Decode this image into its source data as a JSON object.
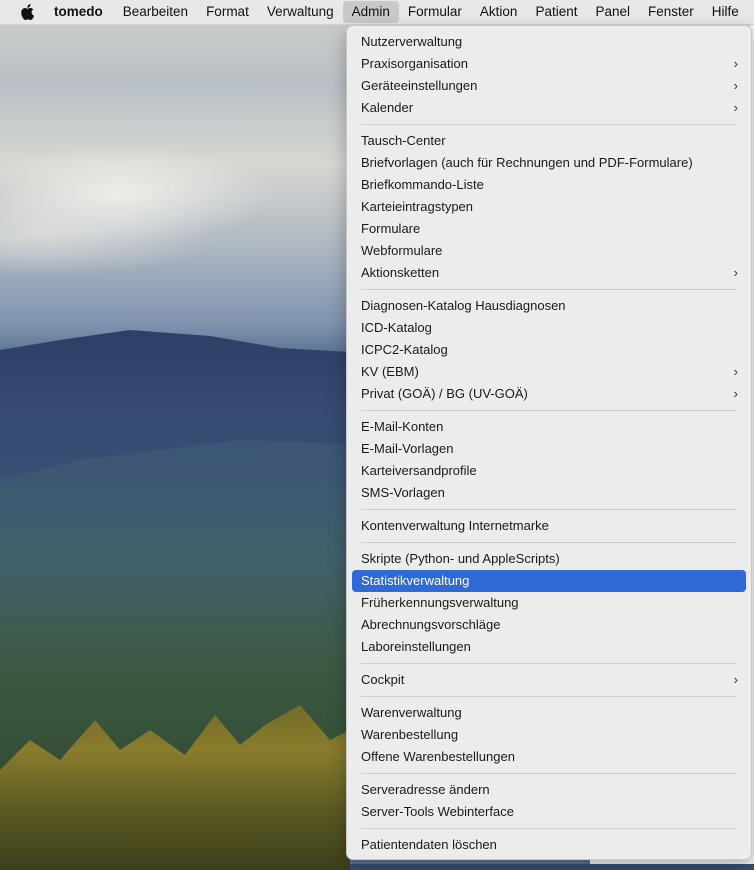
{
  "menubar": {
    "apple_icon": "apple-logo-icon",
    "app_name": "tomedo",
    "items": [
      "Bearbeiten",
      "Format",
      "Verwaltung",
      "Admin",
      "Formular",
      "Aktion",
      "Patient",
      "Panel",
      "Fenster",
      "Hilfe"
    ],
    "active": "Admin"
  },
  "admin_menu": {
    "groups": [
      [
        {
          "label": "Nutzerverwaltung",
          "submenu": false
        },
        {
          "label": "Praxisorganisation",
          "submenu": true
        },
        {
          "label": "Geräteeinstellungen",
          "submenu": true
        },
        {
          "label": "Kalender",
          "submenu": true
        }
      ],
      [
        {
          "label": "Tausch-Center",
          "submenu": false
        },
        {
          "label": "Briefvorlagen (auch für Rechnungen und PDF-Formulare)",
          "submenu": false
        },
        {
          "label": "Briefkommando-Liste",
          "submenu": false
        },
        {
          "label": "Karteieintragstypen",
          "submenu": false
        },
        {
          "label": "Formulare",
          "submenu": false
        },
        {
          "label": "Webformulare",
          "submenu": false
        },
        {
          "label": "Aktionsketten",
          "submenu": true
        }
      ],
      [
        {
          "label": "Diagnosen-Katalog Hausdiagnosen",
          "submenu": false
        },
        {
          "label": "ICD-Katalog",
          "submenu": false
        },
        {
          "label": "ICPC2-Katalog",
          "submenu": false
        },
        {
          "label": "KV (EBM)",
          "submenu": true
        },
        {
          "label": "Privat (GOÄ) / BG (UV-GOÄ)",
          "submenu": true
        }
      ],
      [
        {
          "label": "E-Mail-Konten",
          "submenu": false
        },
        {
          "label": "E-Mail-Vorlagen",
          "submenu": false
        },
        {
          "label": "Karteiversandprofile",
          "submenu": false
        },
        {
          "label": "SMS-Vorlagen",
          "submenu": false
        }
      ],
      [
        {
          "label": "Kontenverwaltung Internetmarke",
          "submenu": false
        }
      ],
      [
        {
          "label": "Skripte (Python- und AppleScripts)",
          "submenu": false
        },
        {
          "label": "Statistikverwaltung",
          "submenu": false,
          "selected": true
        },
        {
          "label": "Früherkennungsverwaltung",
          "submenu": false
        },
        {
          "label": "Abrechnungsvorschläge",
          "submenu": false
        },
        {
          "label": "Laboreinstellungen",
          "submenu": false
        }
      ],
      [
        {
          "label": "Cockpit",
          "submenu": true
        }
      ],
      [
        {
          "label": "Warenverwaltung",
          "submenu": false
        },
        {
          "label": "Warenbestellung",
          "submenu": false
        },
        {
          "label": "Offene Warenbestellungen",
          "submenu": false
        }
      ],
      [
        {
          "label": "Serveradresse ändern",
          "submenu": false
        },
        {
          "label": "Server-Tools Webinterface",
          "submenu": false
        }
      ],
      [
        {
          "label": "Patientendaten löschen",
          "submenu": false
        }
      ]
    ],
    "submenu_glyph": "›",
    "selection_color": "#2f6ad6"
  }
}
